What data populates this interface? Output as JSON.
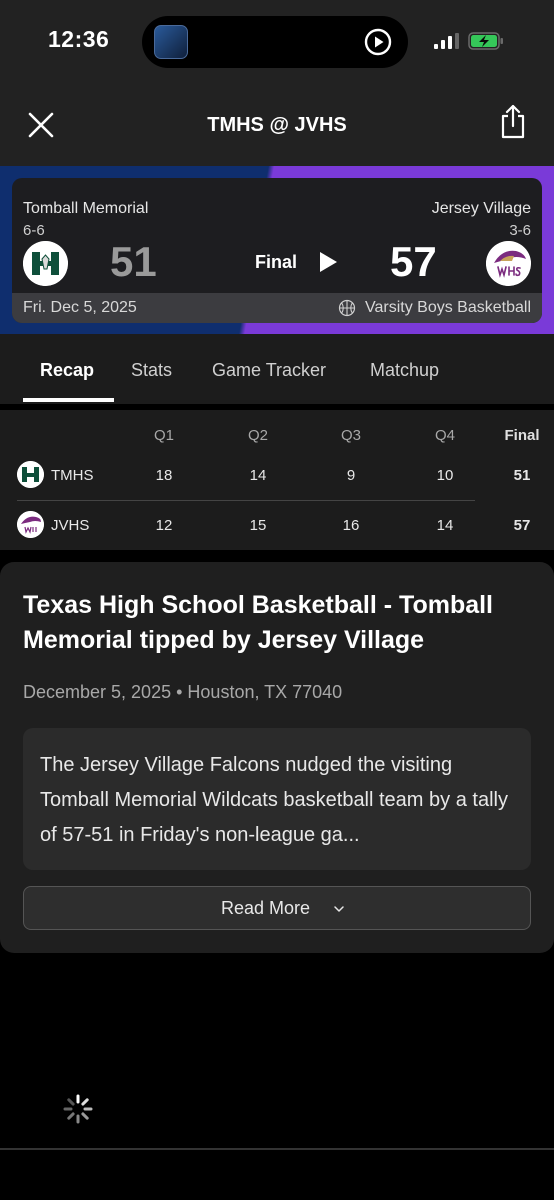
{
  "status_bar": {
    "time": "12:36"
  },
  "header": {
    "title": "TMHS @ JVHS"
  },
  "scoreboard": {
    "home": {
      "name": "Tomball Memorial",
      "record": "6-6",
      "score": "51"
    },
    "away": {
      "name": "Jersey Village",
      "record": "3-6",
      "score": "57"
    },
    "status": "Final",
    "date": "Fri. Dec 5, 2025",
    "sport": "Varsity Boys Basketball",
    "left_color": "#0f2e6e",
    "right_color": "#7a3ad8"
  },
  "tabs": [
    "Recap",
    "Stats",
    "Game Tracker",
    "Matchup"
  ],
  "box_score": {
    "headers": [
      "Q1",
      "Q2",
      "Q3",
      "Q4",
      "Final"
    ],
    "rows": [
      {
        "team": "TMHS",
        "q": [
          "18",
          "14",
          "9",
          "10"
        ],
        "final": "51"
      },
      {
        "team": "JVHS",
        "q": [
          "12",
          "15",
          "16",
          "14"
        ],
        "final": "57"
      }
    ]
  },
  "article": {
    "title": "Texas High School Basketball - Tomball Memorial tipped by Jersey Village",
    "date": "December 5, 2025",
    "location": "Houston, TX 77040",
    "summary": "The Jersey Village Falcons nudged the visiting Tomball Memorial Wildcats basketball team by a tally of 57-51 in Friday's non-league ga...",
    "read_more": "Read More"
  }
}
